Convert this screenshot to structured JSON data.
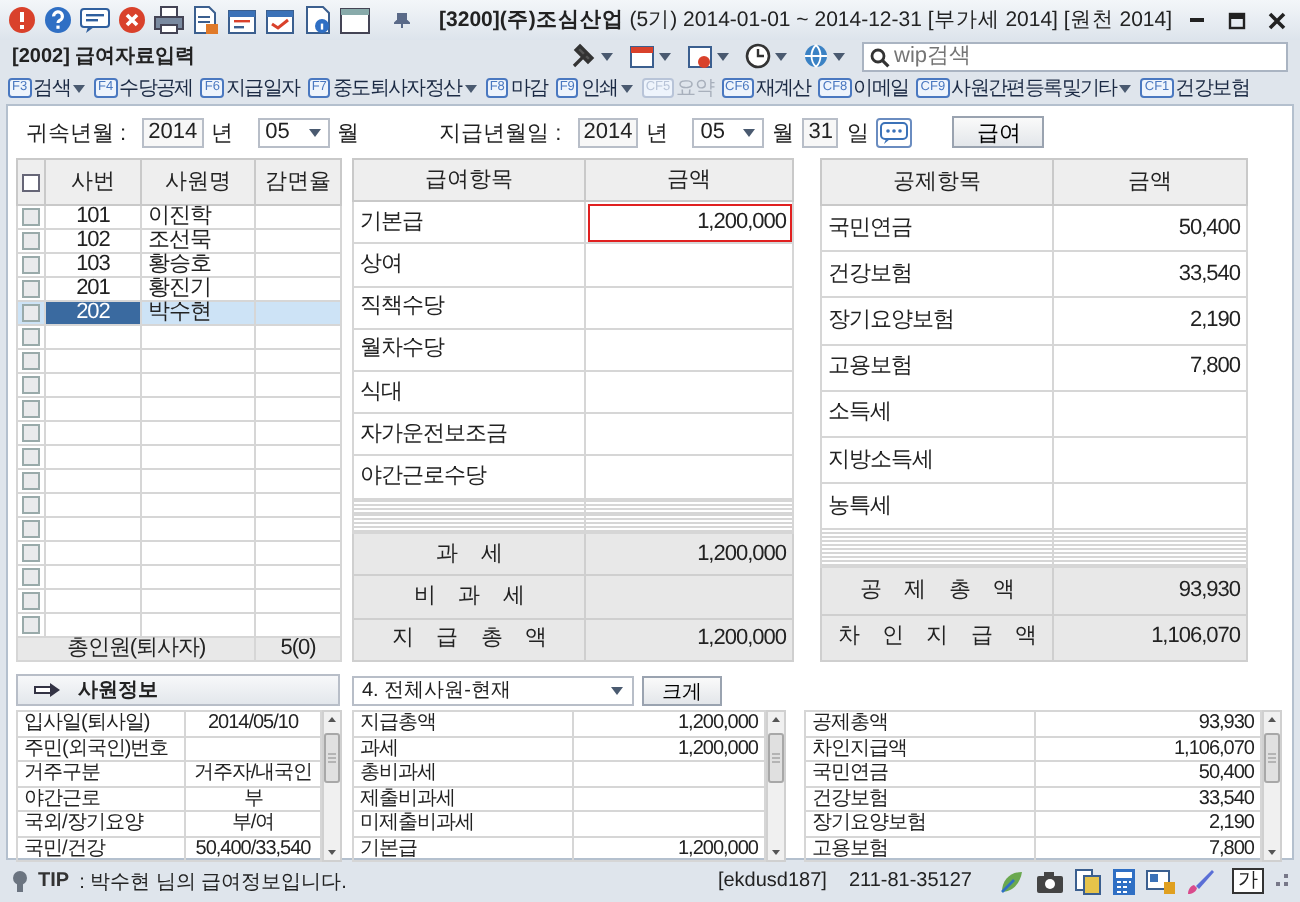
{
  "window": {
    "title": "**[3200](주)조심산업** (5기) 2014-01-01 ~ 2014-12-31 [부가세 2014] [원천 2014]"
  },
  "screen": {
    "title": "[2002] 급여자료입력"
  },
  "search": {
    "placeholder": "wip검색"
  },
  "toolbar": [
    {
      "key": "F3",
      "label": "검색",
      "dropdown": true,
      "disabled": false
    },
    {
      "key": "F4",
      "label": "수당공제",
      "dropdown": false,
      "disabled": false
    },
    {
      "key": "F6",
      "label": "지급일자",
      "dropdown": false,
      "disabled": false
    },
    {
      "key": "F7",
      "label": "중도퇴사자정산",
      "dropdown": true,
      "disabled": false
    },
    {
      "key": "F8",
      "label": "마감",
      "dropdown": false,
      "disabled": false
    },
    {
      "key": "F9",
      "label": "인쇄",
      "dropdown": true,
      "disabled": false
    },
    {
      "key": "CF5",
      "label": "요약",
      "dropdown": false,
      "disabled": true
    },
    {
      "key": "CF6",
      "label": "재계산",
      "dropdown": false,
      "disabled": false
    },
    {
      "key": "CF8",
      "label": "이메일",
      "dropdown": false,
      "disabled": false
    },
    {
      "key": "CF9",
      "label": "사원간편등록및기타",
      "dropdown": true,
      "disabled": false
    },
    {
      "key": "CF1",
      "label": "건강보험",
      "dropdown": false,
      "disabled": false
    }
  ],
  "attribution": {
    "label": "귀속년월 :",
    "year": "2014",
    "year_unit": "년",
    "month": "05",
    "month_unit": "월"
  },
  "payment_date": {
    "label": "지급년월일 :",
    "year": "2014",
    "year_unit": "년",
    "month": "05",
    "month_unit": "월",
    "day": "31",
    "day_unit": "일"
  },
  "pay_type_button": "급여",
  "employees": {
    "all_checked": false,
    "columns": [
      "사번",
      "사원명",
      "감면율"
    ],
    "rows": [
      {
        "number": "101",
        "name": "이진학",
        "checked": false,
        "selected": false
      },
      {
        "number": "102",
        "name": "조선묵",
        "checked": false,
        "selected": false
      },
      {
        "number": "103",
        "name": "황승호",
        "checked": false,
        "selected": false
      },
      {
        "number": "201",
        "name": "황진기",
        "checked": false,
        "selected": false
      },
      {
        "number": "202",
        "name": "박수현",
        "checked": false,
        "selected": true
      }
    ],
    "blank_rows": [
      {
        "checked": false
      },
      {
        "checked": false
      },
      {
        "checked": false
      },
      {
        "checked": false
      },
      {
        "checked": false
      },
      {
        "checked": false
      },
      {
        "checked": false
      },
      {
        "checked": false
      },
      {
        "checked": false
      },
      {
        "checked": false
      },
      {
        "checked": false
      },
      {
        "checked": false
      },
      {
        "checked": false
      }
    ],
    "footer_label": "총인원(퇴사자)",
    "footer_count": "5(0)"
  },
  "pay_items": {
    "columns": [
      "급여항목",
      "금액"
    ],
    "rows": [
      {
        "item": "기본급",
        "amount": "1,200,000",
        "focused": true
      },
      {
        "item": "상여",
        "focused": false
      },
      {
        "item": "직책수당",
        "focused": false
      },
      {
        "item": "월차수당",
        "focused": false
      },
      {
        "item": "식대",
        "focused": false
      },
      {
        "item": "자가운전보조금",
        "focused": false
      },
      {
        "item": "야간근로수당",
        "focused": false
      }
    ],
    "totals": [
      {
        "label": "과 세",
        "amount": "1,200,000"
      },
      {
        "label": "비 과 세"
      },
      {
        "label": "지 급 총 액",
        "amount": "1,200,000"
      }
    ]
  },
  "deductions": {
    "columns": [
      "공제항목",
      "금액"
    ],
    "rows": [
      {
        "item": "국민연금",
        "amount": "50,400"
      },
      {
        "item": "건강보험",
        "amount": "33,540"
      },
      {
        "item": "장기요양보험",
        "amount": "2,190"
      },
      {
        "item": "고용보험",
        "amount": "7,800"
      },
      {
        "item": "소득세"
      },
      {
        "item": "지방소득세"
      },
      {
        "item": "농특세"
      }
    ],
    "totals": [
      {
        "label": "공 제 총 액",
        "amount": "93,930"
      },
      {
        "label": "차 인 지 급 액",
        "amount": "1,106,070"
      }
    ]
  },
  "employee_info": {
    "title": "사원정보",
    "rows": [
      {
        "label": "입사일(퇴사일)",
        "value": "2014/05/10"
      },
      {
        "label": "주민(외국인)번호"
      },
      {
        "label": "거주구분",
        "value": "거주자/내국인"
      },
      {
        "label": "야간근로",
        "value": "부"
      },
      {
        "label": "국외/장기요양",
        "value": "부/여"
      },
      {
        "label": "국민/건강",
        "value": "50,400/33,540"
      }
    ]
  },
  "summary_filter": {
    "value": "4. 전체사원-현재",
    "button": "크게"
  },
  "summary_left": [
    {
      "label": "지급총액",
      "amount": "1,200,000"
    },
    {
      "label": "과세",
      "amount": "1,200,000"
    },
    {
      "label": "총비과세"
    },
    {
      "label": "제출비과세"
    },
    {
      "label": "미제출비과세"
    },
    {
      "label": "기본급",
      "amount": "1,200,000"
    }
  ],
  "summary_right": [
    {
      "label": "공제총액",
      "amount": "93,930"
    },
    {
      "label": "차인지급액",
      "amount": "1,106,070"
    },
    {
      "label": "국민연금",
      "amount": "50,400"
    },
    {
      "label": "건강보험",
      "amount": "33,540"
    },
    {
      "label": "장기요양보험",
      "amount": "2,190"
    },
    {
      "label": "고용보험",
      "amount": "7,800"
    }
  ],
  "status_bar": {
    "tip_label": "TIP",
    "tip_text": ":  박수현 님의 급여정보입니다.",
    "user": "[ekdusd187]",
    "business_number": "211-81-35127",
    "input_mode": "가"
  }
}
